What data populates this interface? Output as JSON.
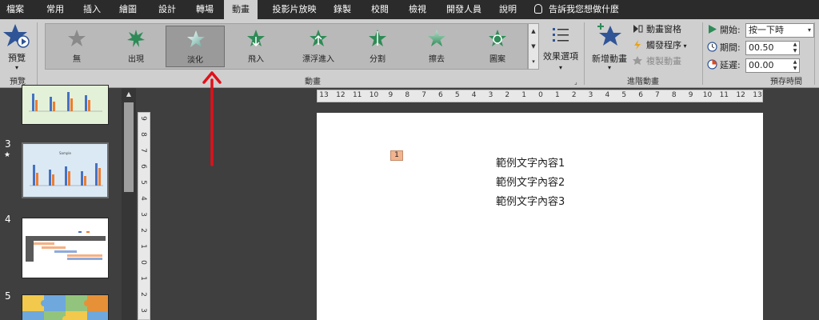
{
  "menu": {
    "tabs": [
      {
        "label": "檔案"
      },
      {
        "label": "常用"
      },
      {
        "label": "插入"
      },
      {
        "label": "繪圖"
      },
      {
        "label": "設計"
      },
      {
        "label": "轉場"
      },
      {
        "label": "動畫"
      },
      {
        "label": "投影片放映"
      },
      {
        "label": "錄製"
      },
      {
        "label": "校閱"
      },
      {
        "label": "檢視"
      },
      {
        "label": "開發人員"
      },
      {
        "label": "說明"
      }
    ],
    "active_tab": "動畫",
    "tell_me": "告訴我您想做什麼"
  },
  "ribbon": {
    "preview": {
      "label": "預覽",
      "group_label": "預覽"
    },
    "animation_group_label": "動畫",
    "animations": [
      {
        "label": "無",
        "color": "#8a8a8a"
      },
      {
        "label": "出現",
        "color": "#2e8b57"
      },
      {
        "label": "淡化",
        "color": "#8fd3c4",
        "selected": true
      },
      {
        "label": "飛入",
        "color": "#2e8b57"
      },
      {
        "label": "漂浮進入",
        "color": "#2e8b57"
      },
      {
        "label": "分割",
        "color": "#2e8b57"
      },
      {
        "label": "擦去",
        "color": "#2e8b57"
      },
      {
        "label": "圖案",
        "color": "#2e8b57"
      }
    ],
    "effect_options": {
      "label": "效果選項"
    },
    "advanced": {
      "add_animation": "新增動畫",
      "animation_pane": "動畫窗格",
      "trigger": "觸發程序",
      "animation_painter": "複製動畫",
      "group_label": "進階動畫"
    },
    "timing": {
      "start_label": "開始:",
      "start_value": "按一下時",
      "duration_label": "期間:",
      "duration_value": "00.50",
      "delay_label": "延遲:",
      "delay_value": "00.00",
      "group_label": "預存時間"
    }
  },
  "thumbnails": [
    {
      "number": "",
      "has_animation": false
    },
    {
      "number": "3",
      "has_animation": true,
      "title": "Sample"
    },
    {
      "number": "4",
      "has_animation": false
    },
    {
      "number": "5",
      "has_animation": false
    }
  ],
  "rulers": {
    "horizontal": [
      "13",
      "12",
      "11",
      "10",
      "9",
      "8",
      "7",
      "6",
      "5",
      "4",
      "3",
      "2",
      "1",
      "0",
      "1",
      "2",
      "3",
      "4",
      "5",
      "6",
      "7",
      "8",
      "9",
      "10",
      "11",
      "12",
      "13"
    ],
    "vertical": [
      "9",
      "8",
      "7",
      "6",
      "5",
      "4",
      "3",
      "2",
      "1",
      "0",
      "1",
      "2",
      "3"
    ]
  },
  "slide": {
    "animation_tag": "1",
    "lines": [
      "範例文字內容1",
      "範例文字內容2",
      "範例文字內容3"
    ]
  },
  "colors": {
    "accent_red": "#e0101a",
    "ribbon_bg": "#cfcfcf",
    "menubar_bg": "#2b2b2b"
  }
}
